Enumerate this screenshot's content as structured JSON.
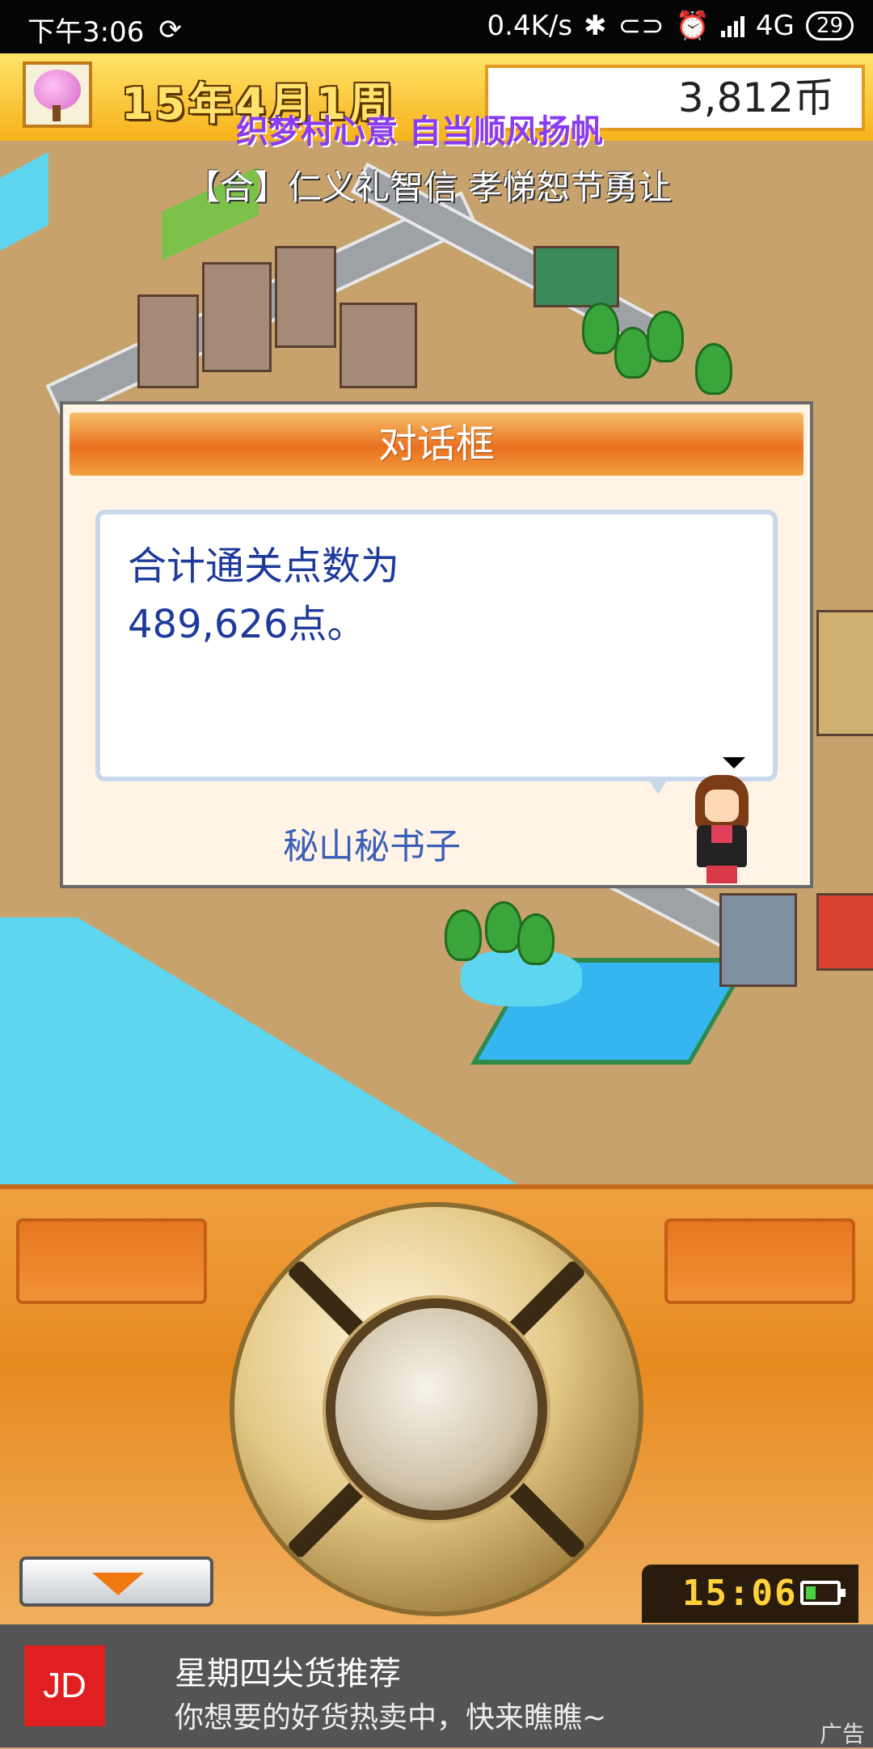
{
  "status_bar": {
    "time": "下午3:06",
    "speed": "0.4K/s",
    "network": "4G",
    "battery": "29"
  },
  "hud": {
    "date": "15年4月1周",
    "money": "3,812币",
    "slogan": "织梦村心意 自当顺风扬帆",
    "banner": "【合】仁义礼智信 孝悌恕节勇让"
  },
  "dialog": {
    "title": "对话框",
    "message_line1": "合计通关点数为",
    "message_line2": "489,626点。",
    "speaker": "秘山秘书子"
  },
  "controls": {
    "clock": "15:06"
  },
  "ad": {
    "logo": "JD",
    "title": "星期四尖货推荐",
    "subtitle": "你想要的好货热卖中，快来瞧瞧~",
    "tag": "广告"
  },
  "colors": {
    "panel_orange": "#e68a20",
    "dialog_header": "#ea7020",
    "message_text": "#1e3a9a",
    "slogan_purple": "#8a3cf0"
  }
}
